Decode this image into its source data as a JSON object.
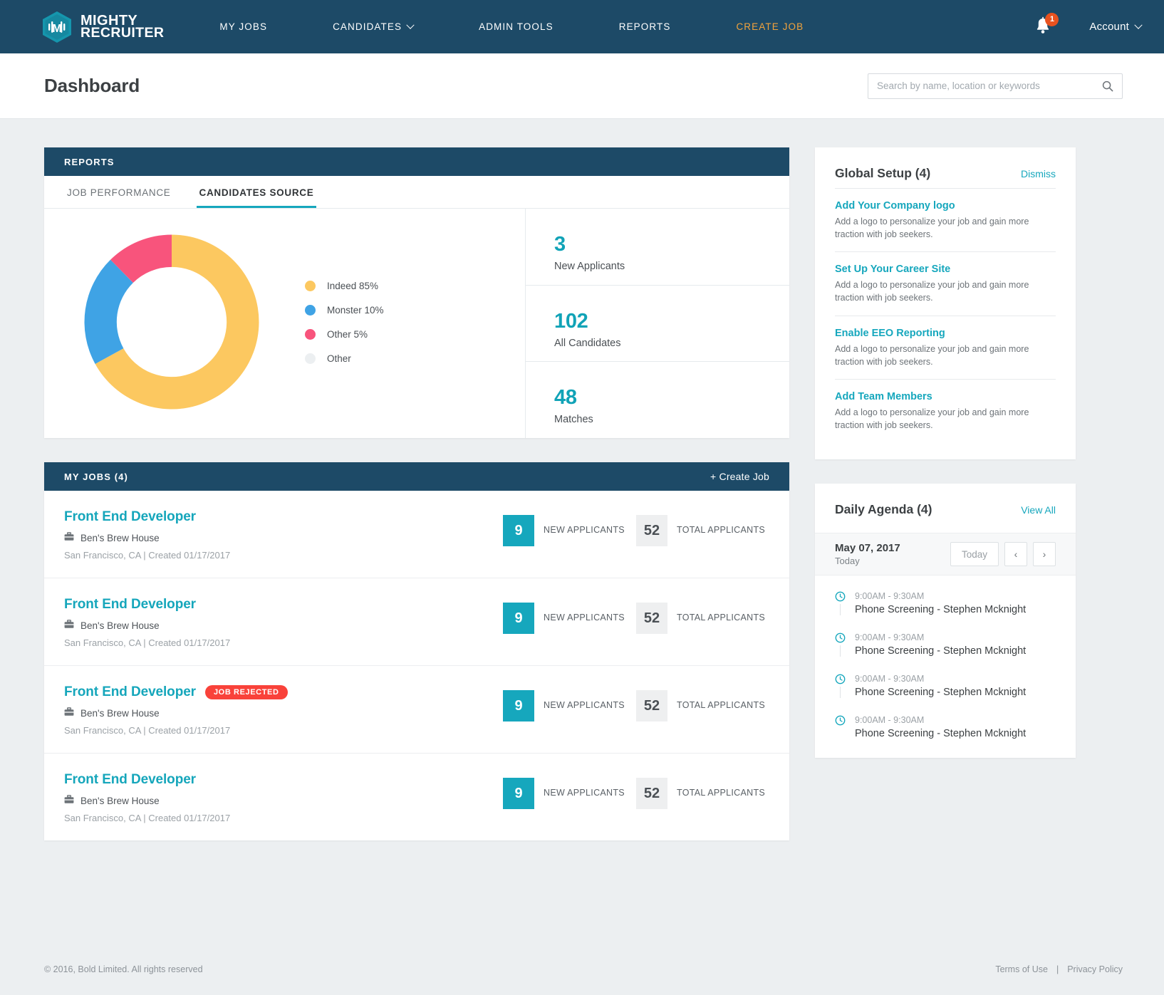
{
  "brand": {
    "line1": "MIGHTY",
    "line2": "RECRUITER",
    "logo_letter": "M"
  },
  "nav": {
    "items": [
      {
        "label": "MY JOBS",
        "has_caret": false,
        "accent": false
      },
      {
        "label": "CANDIDATES",
        "has_caret": true,
        "accent": false
      },
      {
        "label": "ADMIN TOOLS",
        "has_caret": false,
        "accent": false
      },
      {
        "label": "REPORTS",
        "has_caret": false,
        "accent": false
      },
      {
        "label": "CREATE  JOB",
        "has_caret": false,
        "accent": true
      }
    ],
    "notification_count": "1",
    "account_label": "Account"
  },
  "page": {
    "title": "Dashboard"
  },
  "search": {
    "placeholder": "Search by name, location or keywords",
    "value": ""
  },
  "reports": {
    "header": "REPORTS",
    "tabs": [
      {
        "label": "JOB PERFORMANCE",
        "active": false
      },
      {
        "label": "CANDIDATES SOURCE",
        "active": true
      }
    ],
    "stats": [
      {
        "value": "3",
        "label": "New Applicants"
      },
      {
        "value": "102",
        "label": "All Candidates"
      },
      {
        "value": "48",
        "label": "Matches"
      }
    ]
  },
  "chart_data": {
    "type": "pie",
    "title": "Candidates Source",
    "labels": [
      "Indeed 85%",
      "Monster 10%",
      "Other 5%",
      "Other"
    ],
    "categories": [
      "Indeed",
      "Monster",
      "Other",
      "Other"
    ],
    "values": [
      65,
      20,
      12,
      0
    ],
    "display_percents": [
      "85%",
      "10%",
      "5%",
      ""
    ],
    "colors": [
      "#fcc860",
      "#3fa3e5",
      "#f8547c",
      "#eceff1"
    ],
    "donut": true,
    "inner_radius_ratio": 0.63,
    "legend_position": "right",
    "grid": false
  },
  "global_setup": {
    "title": "Global Setup (4)",
    "dismiss_label": "Dismiss",
    "items": [
      {
        "title": "Add Your Company logo",
        "desc": "Add a logo to personalize your job and gain more traction with job seekers."
      },
      {
        "title": "Set Up Your Career Site",
        "desc": "Add a logo to personalize your job and gain more traction with job seekers."
      },
      {
        "title": "Enable EEO Reporting",
        "desc": "Add a logo to personalize your job and gain more traction with job seekers."
      },
      {
        "title": "Add Team Members",
        "desc": "Add a logo to personalize your job and gain more traction with job seekers."
      }
    ]
  },
  "agenda": {
    "title": "Daily Agenda (4)",
    "view_all_label": "View All",
    "date": "May 07, 2017",
    "subtitle": "Today",
    "today_label": "Today",
    "prev_label": "‹",
    "next_label": "›",
    "items": [
      {
        "time": "9:00AM - 9:30AM",
        "event": "Phone Screening - Stephen Mcknight"
      },
      {
        "time": "9:00AM - 9:30AM",
        "event": "Phone Screening - Stephen Mcknight"
      },
      {
        "time": "9:00AM - 9:30AM",
        "event": "Phone Screening - Stephen Mcknight"
      },
      {
        "time": "9:00AM - 9:30AM",
        "event": "Phone Screening - Stephen Mcknight"
      }
    ]
  },
  "myjobs": {
    "header": "MY JOBS (4)",
    "create_label": "+ Create Job",
    "new_applicants_label": "NEW APPLICANTS",
    "total_applicants_label": "TOTAL APPLICANTS",
    "rows": [
      {
        "title": "Front End Developer",
        "badge": "",
        "company": "Ben's Brew House",
        "meta": "San Francisco, CA | Created 01/17/2017",
        "new_count": "9",
        "total_count": "52"
      },
      {
        "title": "Front End Developer",
        "badge": "",
        "company": "Ben's Brew House",
        "meta": "San Francisco, CA | Created 01/17/2017",
        "new_count": "9",
        "total_count": "52"
      },
      {
        "title": "Front End Developer",
        "badge": "JOB REJECTED",
        "company": "Ben's Brew House",
        "meta": "San Francisco, CA | Created 01/17/2017",
        "new_count": "9",
        "total_count": "52"
      },
      {
        "title": "Front End Developer",
        "badge": "",
        "company": "Ben's Brew House",
        "meta": "San Francisco, CA | Created 01/17/2017",
        "new_count": "9",
        "total_count": "52"
      }
    ]
  },
  "footer": {
    "copyright": "© 2016, Bold Limited. All rights reserved",
    "terms": "Terms of Use",
    "separator": "|",
    "privacy": "Privacy Policy"
  },
  "colors": {
    "navy": "#1d4a67",
    "teal": "#16a7bd",
    "orange": "#f2a33c",
    "red": "#f9423a",
    "page_bg": "#eceff1"
  }
}
